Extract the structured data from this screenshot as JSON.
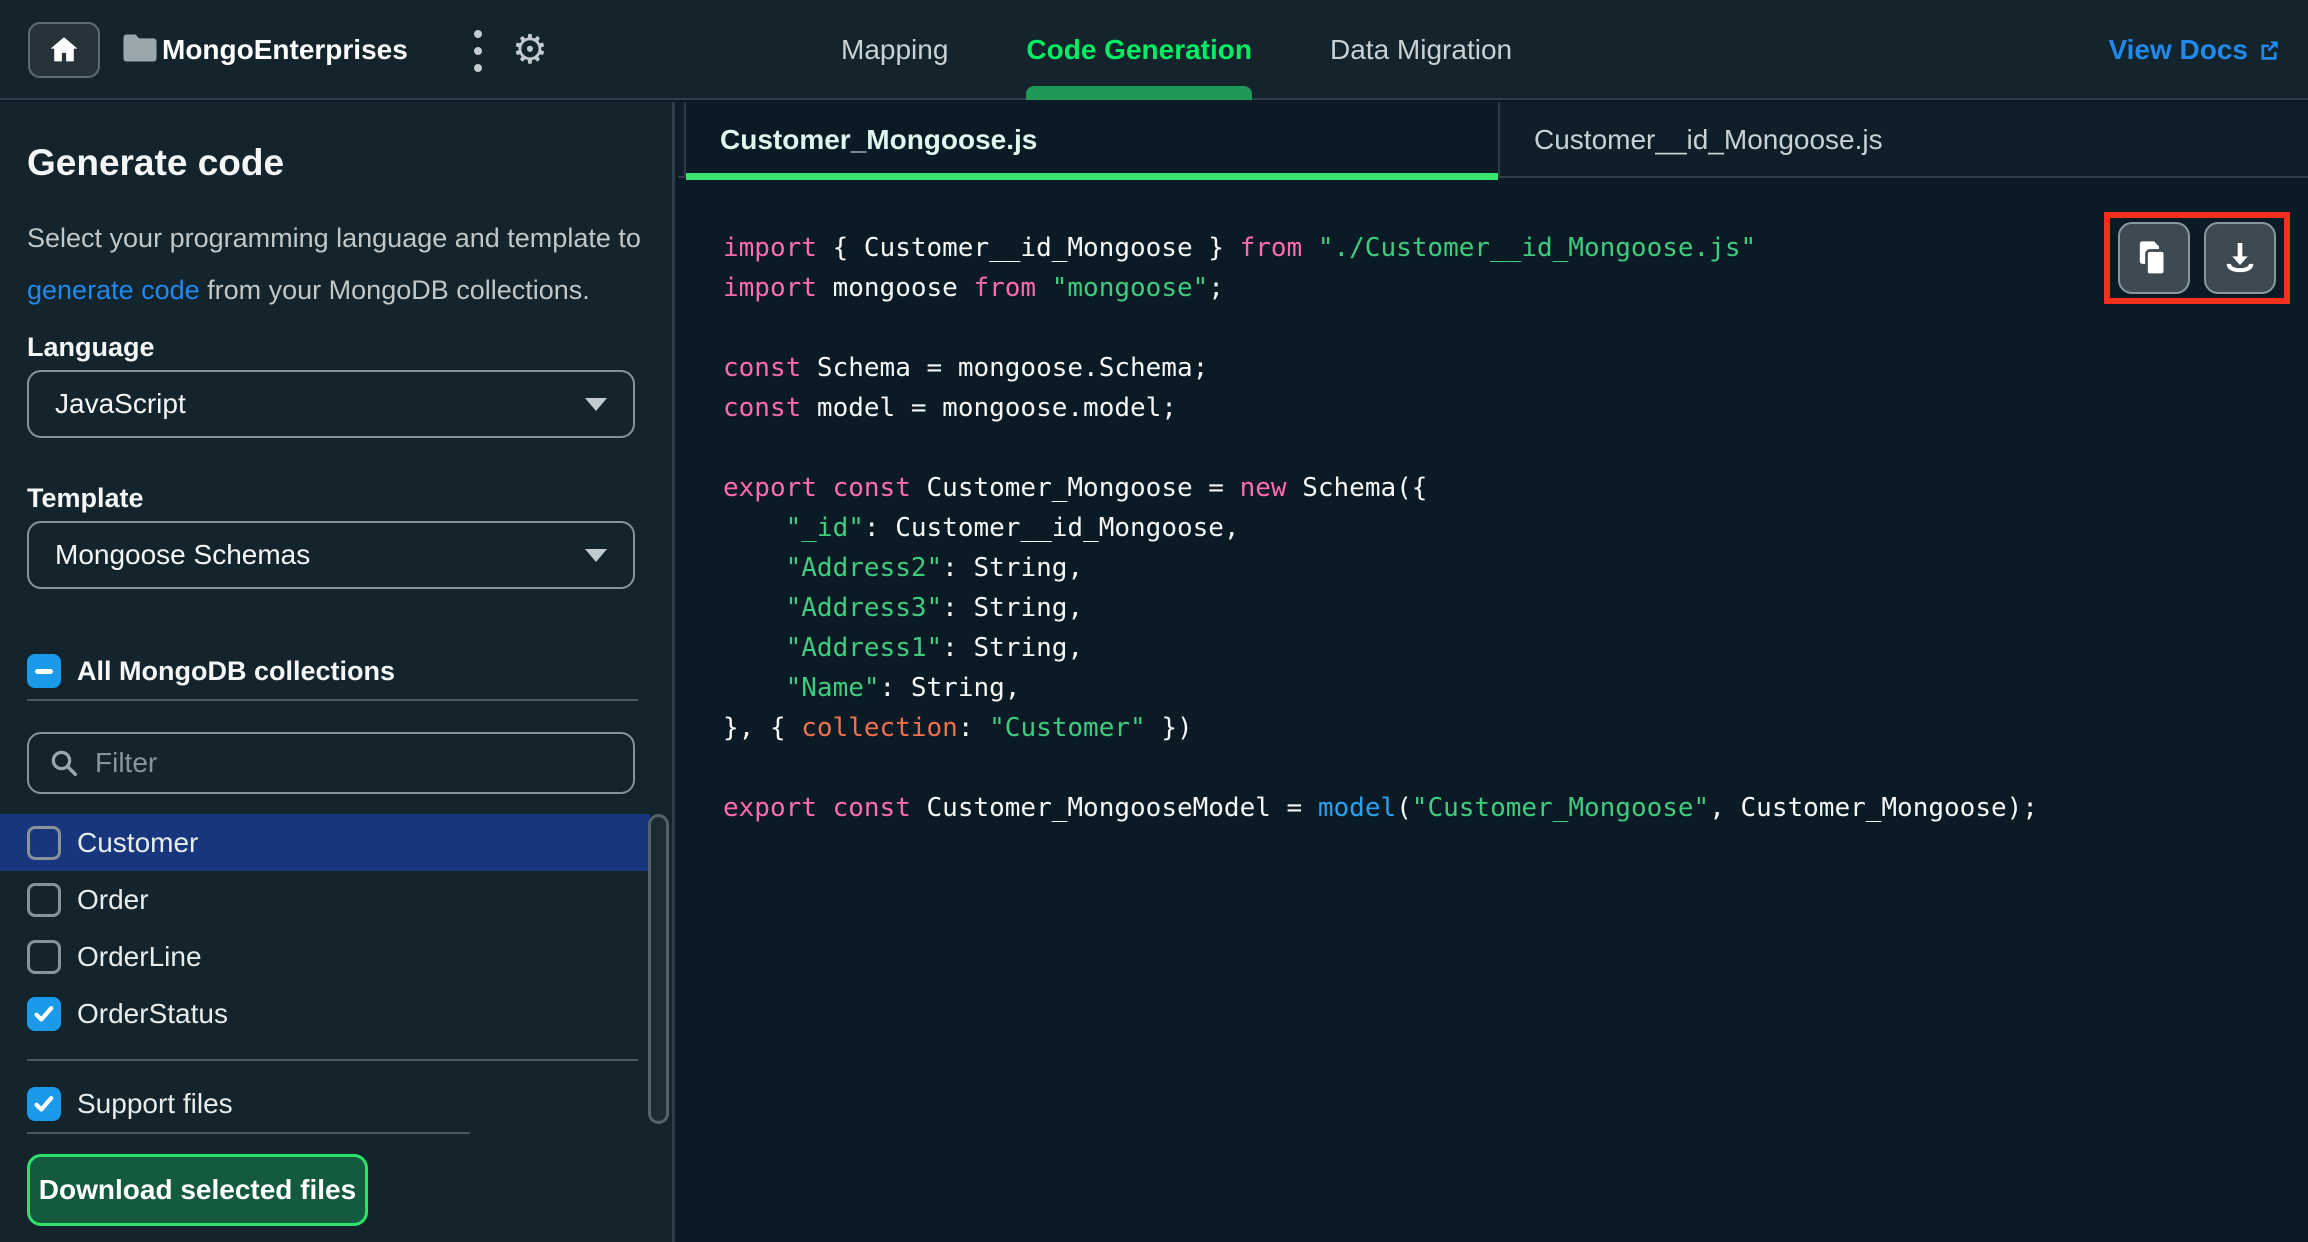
{
  "topbar": {
    "project_name": "MongoEnterprises",
    "nav_tabs": [
      {
        "label": "Mapping",
        "active": false
      },
      {
        "label": "Code Generation",
        "active": true
      },
      {
        "label": "Data Migration",
        "active": false
      }
    ],
    "view_docs_label": "View Docs"
  },
  "sidebar": {
    "title": "Generate code",
    "description_prefix": "Select your programming language and template to ",
    "description_link": "generate code",
    "description_suffix": " from your MongoDB collections.",
    "language_label": "Language",
    "language_value": "JavaScript",
    "template_label": "Template",
    "template_value": "Mongoose Schemas",
    "all_collections_label": "All MongoDB collections",
    "all_collections_state": "indeterminate",
    "filter_placeholder": "Filter",
    "collections": [
      {
        "name": "Customer",
        "checked": false,
        "selected": true
      },
      {
        "name": "Order",
        "checked": false,
        "selected": false
      },
      {
        "name": "OrderLine",
        "checked": false,
        "selected": false
      },
      {
        "name": "OrderStatus",
        "checked": true,
        "selected": false
      }
    ],
    "support_files_label": "Support files",
    "support_files_checked": true,
    "download_button_label": "Download selected files"
  },
  "editor": {
    "file_tabs": [
      {
        "label": "Customer_Mongoose.js",
        "active": true
      },
      {
        "label": "Customer__id_Mongoose.js",
        "active": false
      }
    ],
    "actions": [
      "copy",
      "download"
    ],
    "code_lines": [
      [
        {
          "c": "k",
          "t": "import"
        },
        {
          "c": "p",
          "t": " { Customer__id_Mongoose } "
        },
        {
          "c": "k",
          "t": "from"
        },
        {
          "c": "p",
          "t": " "
        },
        {
          "c": "s",
          "t": "\"./Customer__id_Mongoose.js\""
        }
      ],
      [
        {
          "c": "k",
          "t": "import"
        },
        {
          "c": "p",
          "t": " mongoose "
        },
        {
          "c": "k",
          "t": "from"
        },
        {
          "c": "p",
          "t": " "
        },
        {
          "c": "s",
          "t": "\"mongoose\""
        },
        {
          "c": "p",
          "t": ";"
        }
      ],
      [],
      [
        {
          "c": "k",
          "t": "const"
        },
        {
          "c": "p",
          "t": " Schema = mongoose.Schema;"
        }
      ],
      [
        {
          "c": "k",
          "t": "const"
        },
        {
          "c": "p",
          "t": " model = mongoose.model;"
        }
      ],
      [],
      [
        {
          "c": "k",
          "t": "export"
        },
        {
          "c": "p",
          "t": " "
        },
        {
          "c": "k",
          "t": "const"
        },
        {
          "c": "p",
          "t": " Customer_Mongoose = "
        },
        {
          "c": "k",
          "t": "new"
        },
        {
          "c": "p",
          "t": " Schema({"
        }
      ],
      [
        {
          "c": "p",
          "t": "    "
        },
        {
          "c": "s",
          "t": "\"_id\""
        },
        {
          "c": "p",
          "t": ": Customer__id_Mongoose,"
        }
      ],
      [
        {
          "c": "p",
          "t": "    "
        },
        {
          "c": "s",
          "t": "\"Address2\""
        },
        {
          "c": "p",
          "t": ": String,"
        }
      ],
      [
        {
          "c": "p",
          "t": "    "
        },
        {
          "c": "s",
          "t": "\"Address3\""
        },
        {
          "c": "p",
          "t": ": String,"
        }
      ],
      [
        {
          "c": "p",
          "t": "    "
        },
        {
          "c": "s",
          "t": "\"Address1\""
        },
        {
          "c": "p",
          "t": ": String,"
        }
      ],
      [
        {
          "c": "p",
          "t": "    "
        },
        {
          "c": "s",
          "t": "\"Name\""
        },
        {
          "c": "p",
          "t": ": String,"
        }
      ],
      [
        {
          "c": "p",
          "t": "}, { "
        },
        {
          "c": "o",
          "t": "collection"
        },
        {
          "c": "p",
          "t": ": "
        },
        {
          "c": "s",
          "t": "\"Customer\""
        },
        {
          "c": "p",
          "t": " })"
        }
      ],
      [],
      [
        {
          "c": "k",
          "t": "export"
        },
        {
          "c": "p",
          "t": " "
        },
        {
          "c": "k",
          "t": "const"
        },
        {
          "c": "p",
          "t": " Customer_MongooseModel = "
        },
        {
          "c": "f",
          "t": "model"
        },
        {
          "c": "p",
          "t": "("
        },
        {
          "c": "s",
          "t": "\"Customer_Mongoose\""
        },
        {
          "c": "p",
          "t": ", Customer_Mongoose);"
        }
      ]
    ]
  },
  "colors": {
    "accent_green": "#00ED64",
    "nav_pill_green": "#1F9858",
    "tab_underline_green": "#3CE46F",
    "link_blue": "#2188EC",
    "checkbox_blue": "#1A9AE8",
    "selected_row_blue": "#17367D",
    "highlight_red": "#F23020",
    "download_btn_bg": "#145A3F",
    "download_btn_border": "#2FE06A",
    "code_keyword": "#FF6BB0",
    "code_string": "#3FCC7E",
    "code_function": "#2DA0EE",
    "code_property": "#F0704C"
  }
}
